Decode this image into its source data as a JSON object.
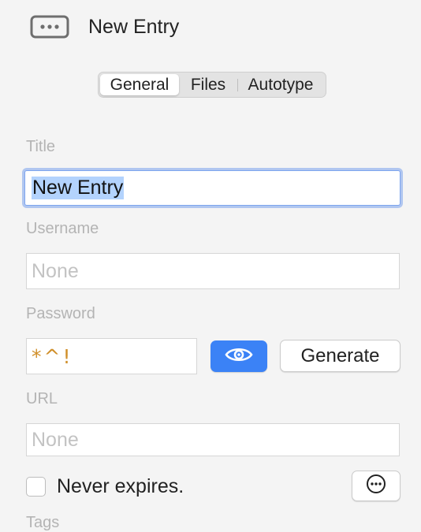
{
  "header": {
    "title": "New Entry",
    "icon": "ellipsis-box-icon"
  },
  "tabs": [
    {
      "label": "General",
      "active": true
    },
    {
      "label": "Files",
      "active": false
    },
    {
      "label": "Autotype",
      "active": false
    }
  ],
  "form": {
    "title": {
      "label": "Title",
      "value": "New Entry"
    },
    "username": {
      "label": "Username",
      "value": "",
      "placeholder": "None"
    },
    "password": {
      "label": "Password",
      "value": "*^!"
    },
    "url": {
      "label": "URL",
      "value": "",
      "placeholder": "None"
    },
    "tags": {
      "label": "Tags"
    }
  },
  "buttons": {
    "reveal_icon": "eye-icon",
    "generate_label": "Generate",
    "more_icon": "ellipsis-circle-icon"
  },
  "expiry": {
    "label": "Never expires.",
    "checked": false
  },
  "colors": {
    "accent": "#3b82f6",
    "selection": "#b3d3fd",
    "focus_ring": "#7ea5ee",
    "password_text": "#d08f2a",
    "label": "#b4b4b4"
  }
}
